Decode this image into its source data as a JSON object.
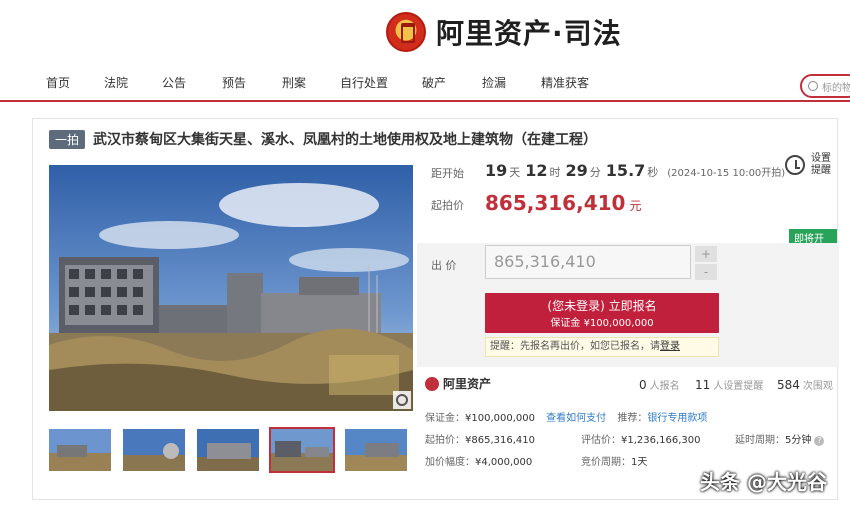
{
  "brand": {
    "text": "阿里资产·司法"
  },
  "nav": {
    "items": [
      "首页",
      "法院",
      "公告",
      "预告",
      "刑案",
      "自行处置",
      "破产",
      "捡漏",
      "精准获客"
    ]
  },
  "search": {
    "placeholder": "标的物"
  },
  "listing": {
    "badge": "一拍",
    "title": "武汉市蔡甸区大集街天星、溪水、凤凰村的土地使用权及地上建筑物（在建工程）"
  },
  "countdown": {
    "label": "距开始",
    "days": "19",
    "days_unit": "天",
    "hours": "12",
    "hours_unit": "时",
    "minutes": "29",
    "minutes_unit": "分",
    "seconds": "15.7",
    "seconds_unit": "秒",
    "start_note": "(2024-10-15 10:00开拍)"
  },
  "start_price": {
    "label": "起拍价",
    "value": "865,316,410",
    "unit": "元"
  },
  "remind": {
    "label": "设置提醒"
  },
  "status_tag": "即将开始",
  "bid": {
    "label": "出 价",
    "value": "865,316,410",
    "plus": "+",
    "minus": "-",
    "signup_line1": "(您未登录) 立即报名",
    "signup_line2": "保证金 ¥100,000,000",
    "tip_text": "提醒：先报名再出价，如您已报名，请",
    "tip_link": "登录"
  },
  "stats": {
    "logo": "阿里资产",
    "signups": "0",
    "signups_label": "人报名",
    "reminders": "11",
    "reminders_label": "人设置提醒",
    "views": "584",
    "views_label": "次围观"
  },
  "info": {
    "deposit_label": "保证金：",
    "deposit_value": "¥100,000,000",
    "deposit_link": "查看如何支付",
    "recommend_label": "推荐：",
    "recommend_link": "银行专用款项",
    "start_label": "起拍价：",
    "start_value": "¥865,316,410",
    "appraisal_label": "评估价：",
    "appraisal_value": "¥1,236,166,300",
    "delay_label": "延时周期：",
    "delay_value": "5分钟",
    "increment_label": "加价幅度：",
    "increment_value": "¥4,000,000",
    "period_label": "竞价周期：",
    "period_value": "1天"
  },
  "watermark": "头条 @大光谷",
  "colors": {
    "accent": "#c1303a",
    "price": "#c1303a",
    "status": "#29a35a",
    "link": "#2e7cc7"
  }
}
